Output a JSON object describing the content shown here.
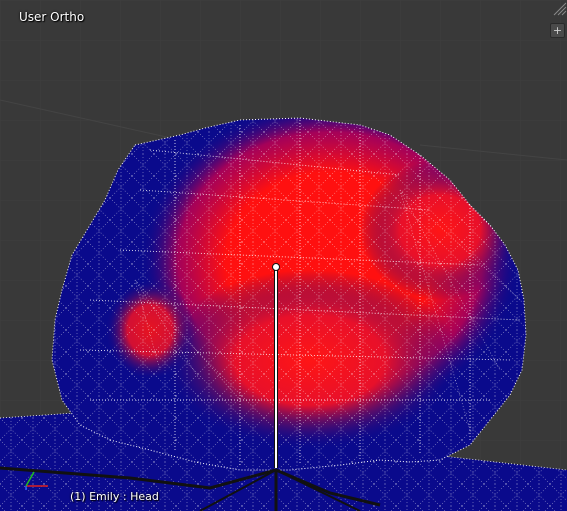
{
  "viewport": {
    "title": "User Ortho",
    "object_label": "(1) Emily : Head",
    "plus_button_label": "+",
    "background_color": "#393939",
    "mesh_base_color": "#0a0a8c",
    "weight_hot_color": "#ff1010",
    "wire_color": "#ffffff",
    "bone_color": "#ffffff",
    "axis_colors": {
      "x": "#e02020",
      "y": "#20c020",
      "z": "#3060ff"
    }
  }
}
